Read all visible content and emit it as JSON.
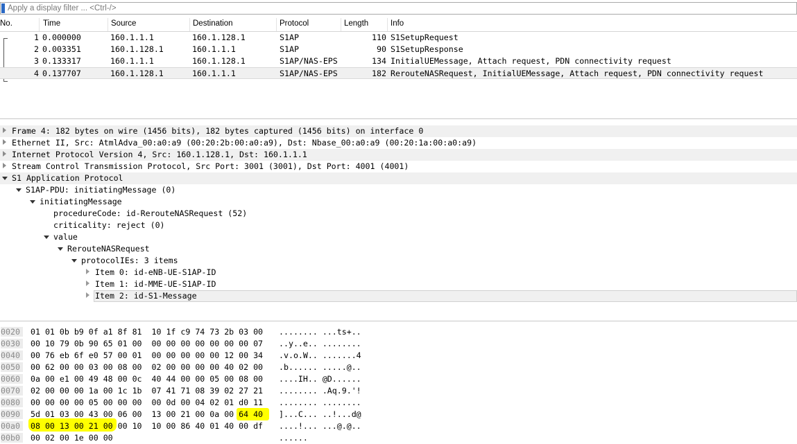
{
  "filter": {
    "placeholder": "Apply a display filter ... <Ctrl-/>",
    "value": ""
  },
  "packet_list": {
    "columns": [
      "No.",
      "Time",
      "Source",
      "Destination",
      "Protocol",
      "Length",
      "Info"
    ],
    "rows": [
      {
        "no": "1",
        "time": "0.000000",
        "source": "160.1.1.1",
        "destination": "160.1.128.1",
        "protocol": "S1AP",
        "length": "110",
        "info": "S1SetupRequest"
      },
      {
        "no": "2",
        "time": "0.003351",
        "source": "160.1.128.1",
        "destination": "160.1.1.1",
        "protocol": "S1AP",
        "length": "90",
        "info": "S1SetupResponse"
      },
      {
        "no": "3",
        "time": "0.133317",
        "source": "160.1.1.1",
        "destination": "160.1.128.1",
        "protocol": "S1AP/NAS-EPS",
        "length": "134",
        "info": "InitialUEMessage, Attach request, PDN connectivity request"
      },
      {
        "no": "4",
        "time": "0.137707",
        "source": "160.1.128.1",
        "destination": "160.1.1.1",
        "protocol": "S1AP/NAS-EPS",
        "length": "182",
        "info": "RerouteNASRequest, InitialUEMessage, Attach request, PDN connectivity request"
      }
    ],
    "selected_row": 3
  },
  "details": [
    {
      "text": "Frame 4: 182 bytes on wire (1456 bits), 182 bytes captured (1456 bits) on interface 0",
      "level": 0,
      "state": "collapsed",
      "shade": true
    },
    {
      "text": "Ethernet II, Src: AtmlAdva_00:a0:a9 (00:20:2b:00:a0:a9), Dst: Nbase_00:a0:a9 (00:20:1a:00:a0:a9)",
      "level": 0,
      "state": "collapsed",
      "shade": false
    },
    {
      "text": "Internet Protocol Version 4, Src: 160.1.128.1, Dst: 160.1.1.1",
      "level": 0,
      "state": "collapsed",
      "shade": true
    },
    {
      "text": "Stream Control Transmission Protocol, Src Port: 3001 (3001), Dst Port: 4001 (4001)",
      "level": 0,
      "state": "collapsed",
      "shade": false
    },
    {
      "text": "S1 Application Protocol",
      "level": 0,
      "state": "expanded",
      "shade": true
    },
    {
      "text": "S1AP-PDU: initiatingMessage (0)",
      "level": 1,
      "state": "expanded",
      "shade": false
    },
    {
      "text": "initiatingMessage",
      "level": 2,
      "state": "expanded",
      "shade": false
    },
    {
      "text": "procedureCode: id-RerouteNASRequest (52)",
      "level": 3,
      "state": "leaf",
      "shade": false
    },
    {
      "text": "criticality: reject (0)",
      "level": 3,
      "state": "leaf",
      "shade": false
    },
    {
      "text": "value",
      "level": 3,
      "state": "expanded",
      "shade": false
    },
    {
      "text": "RerouteNASRequest",
      "level": 4,
      "state": "expanded",
      "shade": false
    },
    {
      "text": "protocolIEs: 3 items",
      "level": 5,
      "state": "expanded",
      "shade": false
    },
    {
      "text": "Item 0: id-eNB-UE-S1AP-ID",
      "level": 6,
      "state": "collapsed",
      "shade": false
    },
    {
      "text": "Item 1: id-MME-UE-S1AP-ID",
      "level": 6,
      "state": "collapsed",
      "shade": false
    },
    {
      "text": "Item 2: id-S1-Message",
      "level": 6,
      "state": "collapsed",
      "shade": false,
      "selected": true
    }
  ],
  "bytes": [
    {
      "offset": "0020",
      "hex": "01 01 0b b9 0f a1 8f 81  10 1f c9 74 73 2b 03 00",
      "ascii": "........ ...ts+.."
    },
    {
      "offset": "0030",
      "hex": "00 10 79 0b 90 65 01 00  00 00 00 00 00 00 00 07",
      "ascii": "..y..e.. ........"
    },
    {
      "offset": "0040",
      "hex": "00 76 eb 6f e0 57 00 01  00 00 00 00 00 12 00 34",
      "ascii": ".v.o.W.. .......4"
    },
    {
      "offset": "0050",
      "hex": "00 62 00 00 03 00 08 00  02 00 00 00 00 40 02 00",
      "ascii": ".b...... .....@.."
    },
    {
      "offset": "0060",
      "hex": "0a 00 e1 00 49 48 00 0c  40 44 00 00 05 00 08 00",
      "ascii": "....IH.. @D......"
    },
    {
      "offset": "0070",
      "hex": "02 00 00 00 1a 00 1c 1b  07 41 71 08 39 02 27 21",
      "ascii": "........ .Aq.9.'!"
    },
    {
      "offset": "0080",
      "hex": "00 00 00 00 05 00 00 00  00 0d 00 04 02 01 d0 11",
      "ascii": "........ ........"
    },
    {
      "offset": "0090",
      "hex": "5d 01 03 00 43 00 06 00  13 00 21 00 0a 00 64 40",
      "ascii": "]...C... ..!...d@"
    },
    {
      "offset": "00a0",
      "hex": "08 00 13 00 21 00 00 10  10 00 86 40 01 40 00 df",
      "ascii": "....!... ...@.@.."
    },
    {
      "offset": "00b0",
      "hex": "00 02 00 1e 00 00",
      "ascii": "......"
    }
  ],
  "colors": {
    "selected_row_bg": "#f0f0f0",
    "highlight": "#ffff00",
    "filter_flag": "#2b69c4"
  }
}
